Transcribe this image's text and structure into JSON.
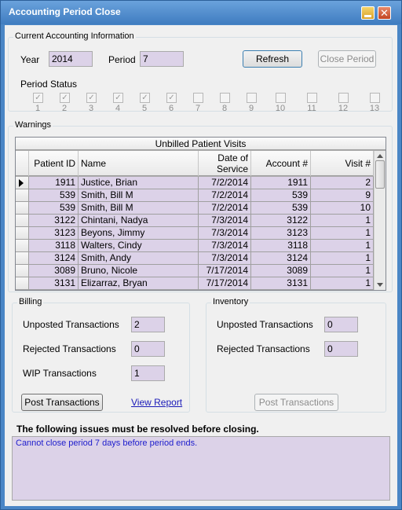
{
  "window": {
    "title": "Accounting Period Close",
    "close_glyph": "✕"
  },
  "current_info": {
    "group_title": "Current Accounting Information",
    "year_label": "Year",
    "year_value": "2014",
    "period_label": "Period",
    "period_value": "7",
    "refresh_label": "Refresh",
    "close_period_label": "Close Period",
    "status_label": "Period Status",
    "periods": [
      {
        "num": "1",
        "checked": true
      },
      {
        "num": "2",
        "checked": true
      },
      {
        "num": "3",
        "checked": true
      },
      {
        "num": "4",
        "checked": true
      },
      {
        "num": "5",
        "checked": true
      },
      {
        "num": "6",
        "checked": true
      },
      {
        "num": "7",
        "checked": false
      },
      {
        "num": "8",
        "checked": false
      },
      {
        "num": "9",
        "checked": false
      },
      {
        "num": "10",
        "checked": false
      },
      {
        "num": "11",
        "checked": false
      },
      {
        "num": "12",
        "checked": false
      },
      {
        "num": "13",
        "checked": false
      }
    ]
  },
  "warnings": {
    "group_title": "Warnings",
    "grid_caption": "Unbilled Patient Visits",
    "columns": [
      "Patient ID",
      "Name",
      "Date of Service",
      "Account #",
      "Visit #"
    ],
    "rows": [
      [
        "1911",
        "Justice, Brian",
        "7/2/2014",
        "1911",
        "2"
      ],
      [
        "539",
        "Smith, Bill M",
        "7/2/2014",
        "539",
        "9"
      ],
      [
        "539",
        "Smith, Bill M",
        "7/2/2014",
        "539",
        "10"
      ],
      [
        "3122",
        "Chintani, Nadya",
        "7/3/2014",
        "3122",
        "1"
      ],
      [
        "3123",
        "Beyons, Jimmy",
        "7/3/2014",
        "3123",
        "1"
      ],
      [
        "3118",
        "Walters, Cindy",
        "7/3/2014",
        "3118",
        "1"
      ],
      [
        "3124",
        "Smith, Andy",
        "7/3/2014",
        "3124",
        "1"
      ],
      [
        "3089",
        "Bruno, Nicole",
        "7/17/2014",
        "3089",
        "1"
      ],
      [
        "3131",
        "Elizarraz, Bryan",
        "7/17/2014",
        "3131",
        "1"
      ]
    ]
  },
  "billing": {
    "group_title": "Billing",
    "unposted_label": "Unposted Transactions",
    "unposted_value": "2",
    "rejected_label": "Rejected Transactions",
    "rejected_value": "0",
    "wip_label": "WIP Transactions",
    "wip_value": "1",
    "post_label": "Post Transactions",
    "report_label": "View Report"
  },
  "inventory": {
    "group_title": "Inventory",
    "unposted_label": "Unposted Transactions",
    "unposted_value": "0",
    "rejected_label": "Rejected Transactions",
    "rejected_value": "0",
    "post_label": "Post Transactions"
  },
  "issues": {
    "heading": "The following issues must be resolved before closing.",
    "message": "Cannot close period 7 days before period ends."
  },
  "colors": {
    "field_bg": "#dcd2e8",
    "title_bar": "#4a86c6",
    "issue_text": "#1c1ccc"
  }
}
